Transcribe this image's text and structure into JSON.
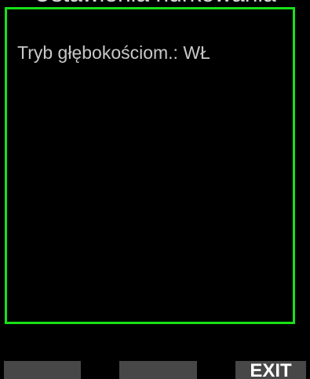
{
  "header": {
    "title": "Ustawienia nurkowania"
  },
  "panel": {
    "row_text": "Tryb głębokościom.: WŁ",
    "border_color": "#18e018"
  },
  "softkeys": {
    "left_label": "",
    "middle_label": "",
    "right_label": "EXIT"
  }
}
